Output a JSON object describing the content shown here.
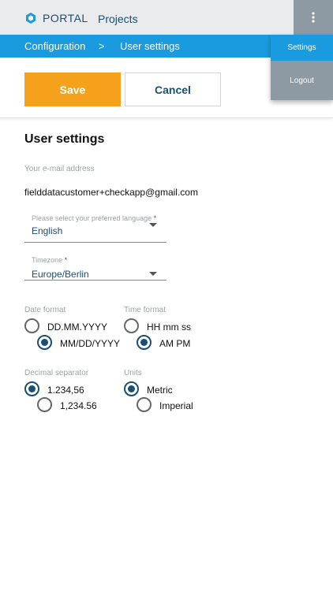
{
  "header": {
    "brand": "PORTAL",
    "nav_projects": "Projects",
    "logo_icon": "hexagon-logo-icon",
    "menu_icon": "more-vert-icon"
  },
  "breadcrumb": {
    "items": [
      "Configuration",
      ">",
      "User settings"
    ]
  },
  "actions": {
    "save_label": "Save",
    "cancel_label": "Cancel"
  },
  "menu": {
    "items": [
      "Settings",
      "Logout"
    ]
  },
  "form": {
    "title": "User settings",
    "email_label": "Your e-mail address",
    "email_value": "fielddatacustomer+checkapp@gmail.com",
    "language_label": "Please select your preferred language",
    "language_value": "English",
    "timezone_label": "Timezone",
    "timezone_value": "Europe/Berlin",
    "required_marker": "*",
    "date_format": {
      "label": "Date format",
      "options": [
        "DD.MM.YYYY",
        "MM/DD/YYYY"
      ],
      "selected": "MM/DD/YYYY"
    },
    "time_format": {
      "label": "Time format",
      "options": [
        "HH mm ss",
        "AM PM"
      ],
      "selected": "AM PM"
    },
    "decimal_separator": {
      "label": "Decimal separator",
      "options": [
        "1.234,56",
        "1,234.56"
      ],
      "selected": "1.234,56"
    },
    "units": {
      "label": "Units",
      "options": [
        "Metric",
        "Imperial"
      ],
      "selected": "Metric"
    }
  },
  "colors": {
    "accent_blue": "#1a9be0",
    "dark_blue": "#1a4e73",
    "save_orange": "#f5a11c",
    "menu_grey": "#8e9aa3"
  }
}
